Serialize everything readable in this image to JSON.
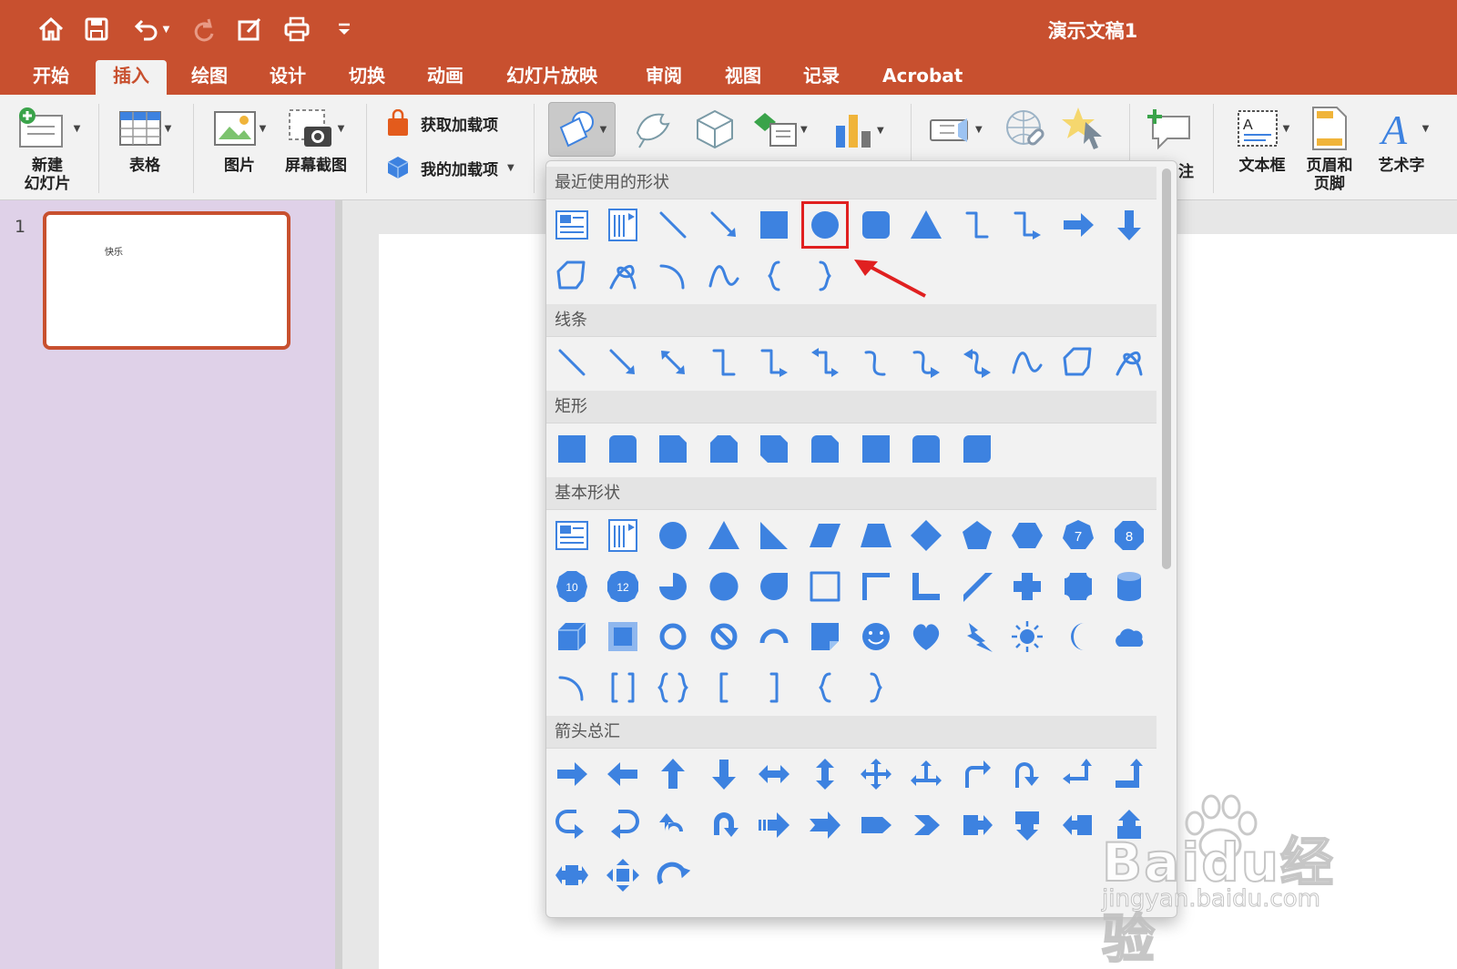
{
  "window": {
    "title": "演示文稿1"
  },
  "tabs": [
    "开始",
    "插入",
    "绘图",
    "设计",
    "切换",
    "动画",
    "幻灯片放映",
    "审阅",
    "视图",
    "记录",
    "Acrobat"
  ],
  "active_tab": "插入",
  "ribbon": {
    "new_slide": "新建\n幻灯片",
    "table": "表格",
    "picture": "图片",
    "screenshot": "屏幕截图",
    "get_addins": "获取加载项",
    "my_addins": "我的加载项",
    "comment_partial": "注",
    "textbox": "文本框",
    "header_footer": "页眉和\n页脚",
    "wordart": "艺术字"
  },
  "slides_pane": {
    "slide_number": "1",
    "thumb_text": "快乐"
  },
  "shapes_gallery": {
    "sections": [
      "最近使用的形状",
      "线条",
      "矩形",
      "基本形状",
      "箭头总汇"
    ],
    "selected_shape": "oval",
    "accent_color": "#3d82e0",
    "highlight_color": "#e02020"
  },
  "watermark": {
    "brand": "Baidu经验",
    "url": "jingyan.baidu.com"
  }
}
